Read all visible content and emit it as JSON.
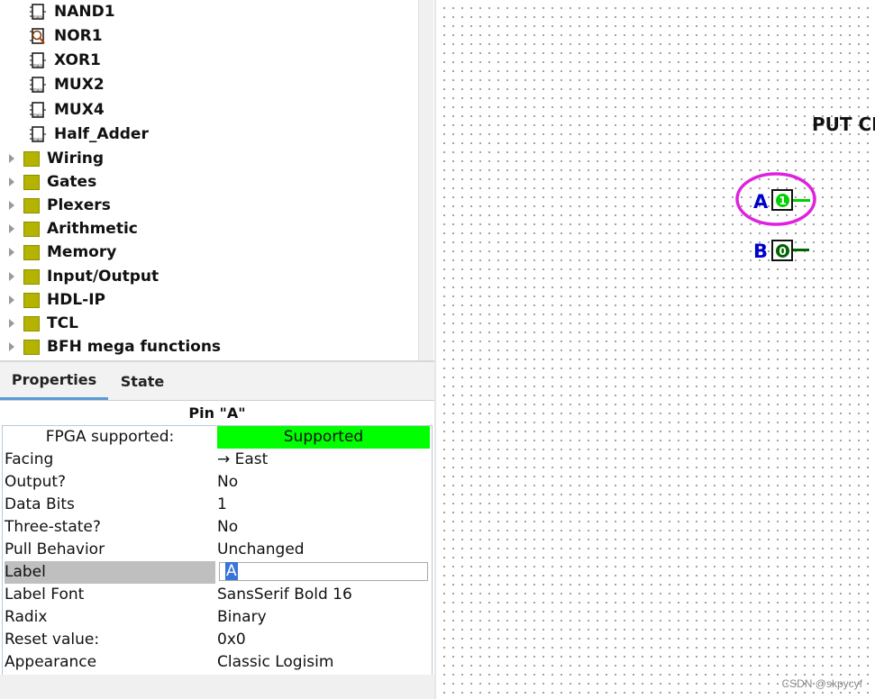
{
  "tree": {
    "circuits": [
      {
        "label": "NAND1",
        "icon": "chip-icon"
      },
      {
        "label": "NOR1",
        "icon": "chip-magnifier-icon"
      },
      {
        "label": "XOR1",
        "icon": "chip-icon"
      },
      {
        "label": "MUX2",
        "icon": "chip-icon"
      },
      {
        "label": "MUX4",
        "icon": "chip-icon"
      },
      {
        "label": "Half_Adder",
        "icon": "chip-icon"
      }
    ],
    "libraries": [
      {
        "label": "Wiring"
      },
      {
        "label": "Gates"
      },
      {
        "label": "Plexers"
      },
      {
        "label": "Arithmetic"
      },
      {
        "label": "Memory"
      },
      {
        "label": "Input/Output"
      },
      {
        "label": "HDL-IP"
      },
      {
        "label": "TCL"
      },
      {
        "label": "BFH mega functions"
      }
    ]
  },
  "tabs": {
    "properties": "Properties",
    "state": "State"
  },
  "properties": {
    "title": "Pin \"A\"",
    "rows": [
      {
        "key": "FPGA supported:",
        "value": "Supported"
      },
      {
        "key": "Facing",
        "value": "→ East"
      },
      {
        "key": "Output?",
        "value": "No"
      },
      {
        "key": "Data Bits",
        "value": "1"
      },
      {
        "key": "Three-state?",
        "value": "No"
      },
      {
        "key": "Pull Behavior",
        "value": "Unchanged"
      },
      {
        "key": "Label",
        "value": "A"
      },
      {
        "key": "Label Font",
        "value": "SansSerif Bold 16"
      },
      {
        "key": "Radix",
        "value": "Binary"
      },
      {
        "key": "Reset value:",
        "value": "0x0"
      },
      {
        "key": "Appearance",
        "value": "Classic Logisim"
      }
    ]
  },
  "canvas": {
    "title": "PUT CI",
    "pins": [
      {
        "label": "A",
        "value": "1",
        "selected": true
      },
      {
        "label": "B",
        "value": "0",
        "selected": false
      }
    ],
    "colors": {
      "pin_high": "#00d000",
      "pin_low": "#006400",
      "selection": "#e020e0",
      "label": "#0000cc"
    }
  },
  "watermark": "CSDN @skpycyf"
}
